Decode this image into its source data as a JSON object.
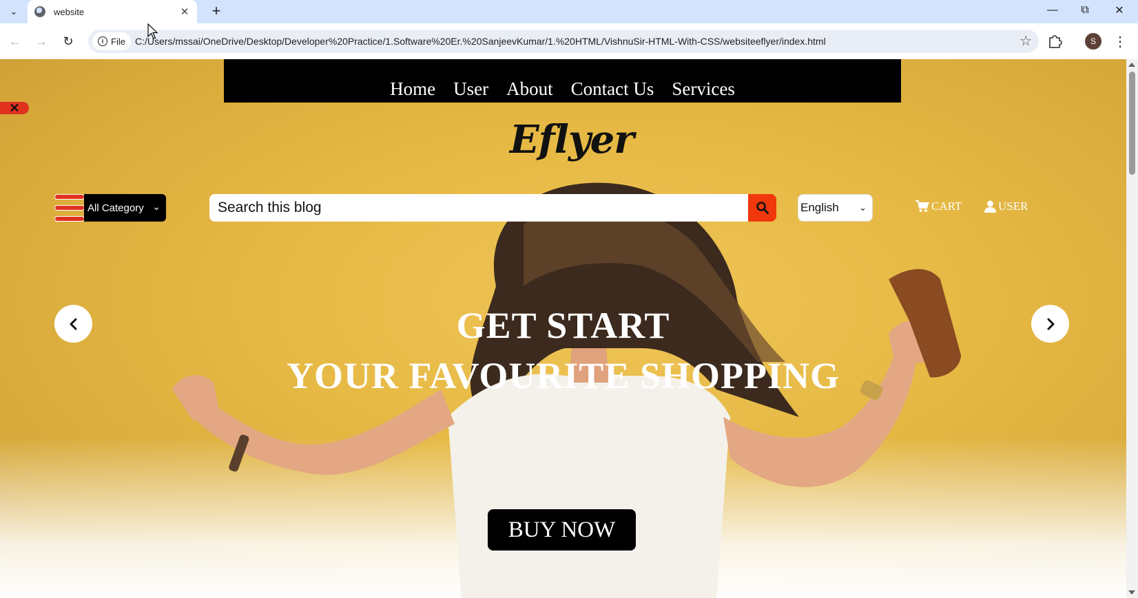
{
  "browser": {
    "tab_title": "website",
    "file_chip_label": "File",
    "url": "C:/Users/mssai/OneDrive/Desktop/Developer%20Practice/1.Software%20Er.%20SanjeevKumar/1.%20HTML/VishnuSir-HTML-With-CSS/websiteeflyer/index.html",
    "profile_initial": "S"
  },
  "site": {
    "nav": {
      "home": "Home",
      "user": "User",
      "about": "About",
      "contact": "Contact Us",
      "services": "Services"
    },
    "logo": "Eflyer",
    "category_select": "All Category",
    "search_placeholder": "Search this blog",
    "language_select": "English",
    "cart_label": "CART",
    "user_label": "USER",
    "hero_line1": "GET START",
    "hero_line2": "YOUR FAVOURITE SHOPPING",
    "buy_button": "BUY NOW"
  },
  "colors": {
    "accent": "#f0380c",
    "hero_background": "#e6b944",
    "nav_background": "#000000"
  }
}
